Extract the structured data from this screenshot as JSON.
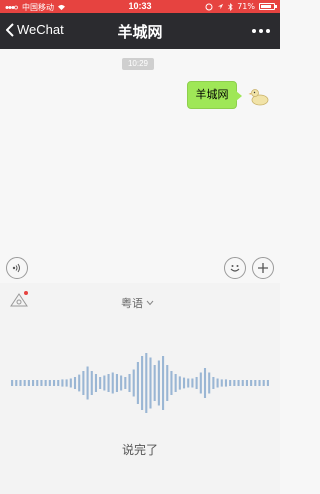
{
  "status_bar": {
    "carrier": "中国移动",
    "time": "10:33",
    "battery": "71%"
  },
  "nav": {
    "back_label": "WeChat",
    "title": "羊城网"
  },
  "chat": {
    "timestamp": "10:29",
    "messages": [
      {
        "sender": "me",
        "text": "羊城网"
      }
    ]
  },
  "voice_input": {
    "language": "粤语",
    "done_label": "说完了",
    "waveform_levels": [
      0.1,
      0.1,
      0.1,
      0.1,
      0.1,
      0.1,
      0.1,
      0.1,
      0.1,
      0.1,
      0.1,
      0.1,
      0.12,
      0.12,
      0.15,
      0.2,
      0.28,
      0.4,
      0.55,
      0.4,
      0.3,
      0.2,
      0.25,
      0.3,
      0.35,
      0.3,
      0.25,
      0.2,
      0.3,
      0.45,
      0.7,
      0.9,
      1.0,
      0.85,
      0.6,
      0.75,
      0.9,
      0.6,
      0.4,
      0.3,
      0.22,
      0.18,
      0.15,
      0.15,
      0.2,
      0.35,
      0.5,
      0.35,
      0.2,
      0.15,
      0.12,
      0.12,
      0.1,
      0.1,
      0.1,
      0.1,
      0.1,
      0.1,
      0.1,
      0.1,
      0.1,
      0.1
    ],
    "waveform_color": "#9ab6d4"
  },
  "colors": {
    "status_bar": "#e64340",
    "nav_bar": "#2b2b2f",
    "bubble": "#9fe757"
  }
}
